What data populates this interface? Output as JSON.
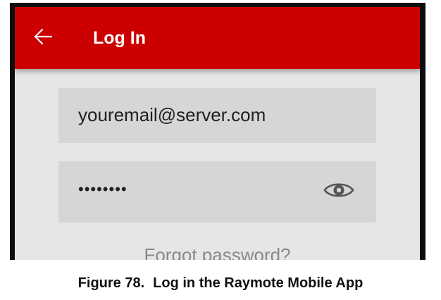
{
  "app_bar": {
    "title": "Log In",
    "back_icon": "arrow-left-icon",
    "background_color": "#cc0000"
  },
  "form": {
    "email_value": "youremail@server.com",
    "password_value": "••••••••",
    "password_toggle_icon": "eye-icon",
    "forgot_password_label": "Forgot password?"
  },
  "caption": {
    "figure_number": "Figure 78.",
    "text": "Log in the Raymote Mobile App"
  }
}
